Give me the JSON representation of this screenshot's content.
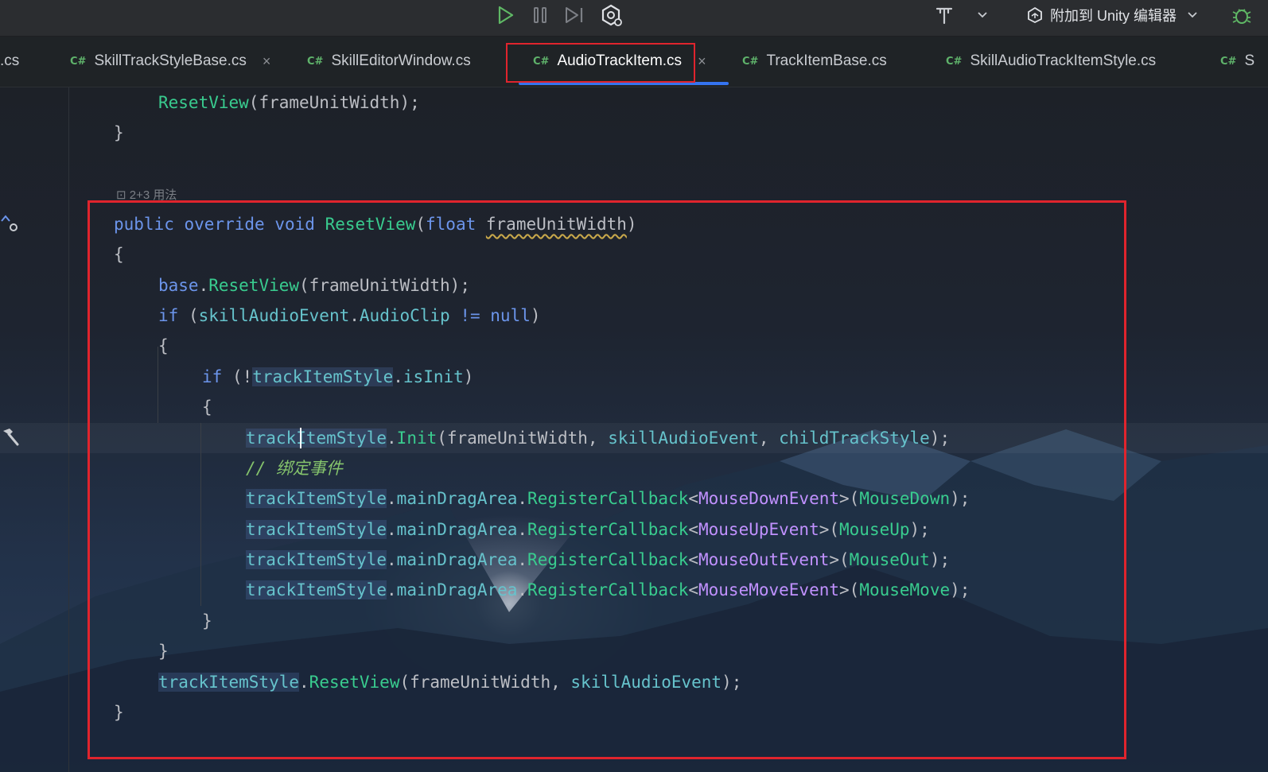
{
  "toolbar": {
    "attach_label": "附加到 Unity 编辑器",
    "icons": [
      "run-icon",
      "pause-icon",
      "step-icon",
      "debug-attach-icon",
      "build-icon",
      "chevron-down-icon",
      "unity-icon",
      "bug-icon"
    ]
  },
  "tabs": [
    {
      "icon": "C#",
      "label": ".cs"
    },
    {
      "icon": "C#",
      "label": "SkillTrackStyleBase.cs",
      "closable": true
    },
    {
      "icon": "C#",
      "label": "SkillEditorWindow.cs"
    },
    {
      "icon": "C#",
      "label": "AudioTrackItem.cs",
      "closable": true,
      "active": true
    },
    {
      "icon": "C#",
      "label": "TrackItemBase.cs"
    },
    {
      "icon": "C#",
      "label": "SkillAudioTrackItemStyle.cs"
    },
    {
      "icon": "C#",
      "label": "S"
    }
  ],
  "tab_close_glyph": "×",
  "editor": {
    "usage_hint": "⊡ 2+3 用法",
    "lines": {
      "l1": {
        "fn": "ResetView",
        "rest": "(frameUnitWidth);"
      },
      "l2": "}",
      "l3": {
        "kw1": "public",
        "kw2": "override",
        "kw3": "void",
        "fn": "ResetView",
        "p1": "(",
        "kw4": "float",
        "param": "frameUnitWidth",
        "p2": ")"
      },
      "l4": "{",
      "l5": {
        "kw": "base",
        "dot": ".",
        "fn": "ResetView",
        "rest": "(frameUnitWidth);"
      },
      "l6": {
        "kw": "if",
        "p1": " (",
        "obj": "skillAudioEvent",
        "dot": ".",
        "prop": "AudioClip",
        "op": " != ",
        "kw2": "null",
        "p2": ")"
      },
      "l7": "{",
      "l8": {
        "kw": "if",
        "p1": " (!",
        "obj": "trackItemStyle",
        "dot": ".",
        "prop": "isInit",
        "p2": ")"
      },
      "l9": "{",
      "l10": {
        "obj": "trackItemStyle",
        "dot": ".",
        "fn": "Init",
        "p1": "(frameUnitWidth, ",
        "a1": "skillAudioEvent",
        "sep": ", ",
        "a2": "childTrackStyle",
        "p2": ");"
      },
      "l11": "// 绑定事件",
      "l12": {
        "obj": "trackItemStyle",
        "dot": ".",
        "prop": "mainDragArea",
        "dot2": ".",
        "fn": "RegisterCallback",
        "lt": "<",
        "ty": "MouseDownEvent",
        "gt": ">(",
        "arg": "MouseDown",
        "end": ");"
      },
      "l13": {
        "obj": "trackItemStyle",
        "dot": ".",
        "prop": "mainDragArea",
        "dot2": ".",
        "fn": "RegisterCallback",
        "lt": "<",
        "ty": "MouseUpEvent",
        "gt": ">(",
        "arg": "MouseUp",
        "end": ");"
      },
      "l14": {
        "obj": "trackItemStyle",
        "dot": ".",
        "prop": "mainDragArea",
        "dot2": ".",
        "fn": "RegisterCallback",
        "lt": "<",
        "ty": "MouseOutEvent",
        "gt": ">(",
        "arg": "MouseOut",
        "end": ");"
      },
      "l15": {
        "obj": "trackItemStyle",
        "dot": ".",
        "prop": "mainDragArea",
        "dot2": ".",
        "fn": "RegisterCallback",
        "lt": "<",
        "ty": "MouseMoveEvent",
        "gt": ">(",
        "arg": "MouseMove",
        "end": ");"
      },
      "l16": "}",
      "l17": "}",
      "l18": {
        "obj": "trackItemStyle",
        "dot": ".",
        "fn": "ResetView",
        "p1": "(frameUnitWidth, ",
        "a1": "skillAudioEvent",
        "p2": ");"
      },
      "l19": "}"
    }
  },
  "colors": {
    "keyword": "#6c95eb",
    "method": "#39cc8f",
    "type": "#c191ff",
    "property": "#66c3cc",
    "comment": "#85c46c",
    "highlight_box": "#e0242d",
    "tab_underline": "#3574f0"
  }
}
